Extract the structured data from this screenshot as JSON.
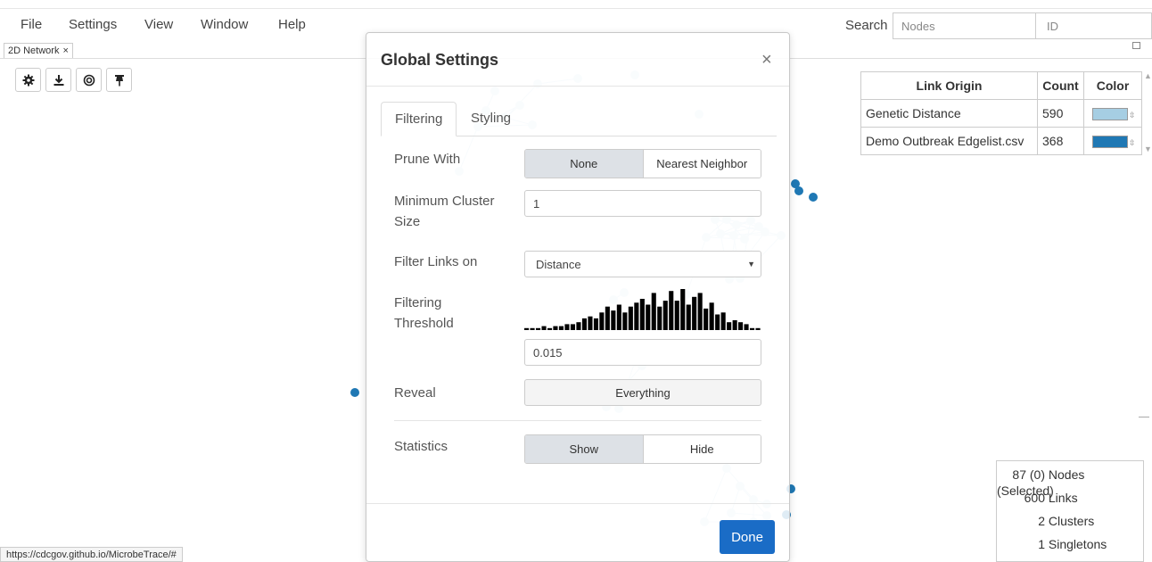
{
  "menu": {
    "items": [
      "File",
      "Settings",
      "View",
      "Window",
      "Help"
    ],
    "search_label": "Search",
    "search_placeholder": "Nodes",
    "id_placeholder": "ID"
  },
  "tab": {
    "label": "2D Network",
    "close": "×"
  },
  "toolbar": {
    "icons": [
      "gear-icon",
      "download-icon",
      "target-icon",
      "pin-icon"
    ]
  },
  "link_table": {
    "headers": [
      "Link Origin",
      "Count",
      "Color"
    ],
    "rows": [
      {
        "origin": "Genetic Distance",
        "count": "590",
        "color": "#a6cee3"
      },
      {
        "origin": "Demo Outbreak Edgelist.csv",
        "count": "368",
        "color": "#1f78b4"
      }
    ]
  },
  "stats": {
    "nodes": {
      "value": "87 (0)",
      "label": "Nodes (Selected)"
    },
    "links": {
      "value": "600",
      "label": "Links"
    },
    "clusters": {
      "value": "2",
      "label": "Clusters"
    },
    "singletons": {
      "value": "1",
      "label": "Singletons"
    }
  },
  "status_url": "https://cdcgov.github.io/MicrobeTrace/#",
  "modal": {
    "title": "Global Settings",
    "close": "×",
    "tabs": [
      "Filtering",
      "Styling"
    ],
    "prune_label": "Prune With",
    "prune_options": [
      "None",
      "Nearest Neighbor"
    ],
    "min_cluster_label": "Minimum Cluster Size",
    "min_cluster_value": "1",
    "filter_links_label": "Filter Links on",
    "filter_links_value": "Distance",
    "threshold_label": "Filtering Threshold",
    "threshold_value": "0.015",
    "reveal_label": "Reveal",
    "reveal_button": "Everything",
    "statistics_label": "Statistics",
    "statistics_options": [
      "Show",
      "Hide"
    ],
    "done_label": "Done"
  },
  "histogram_bins": [
    1,
    1,
    1,
    2,
    1,
    2,
    2,
    3,
    3,
    4,
    6,
    7,
    6,
    9,
    12,
    10,
    13,
    9,
    12,
    14,
    16,
    13,
    19,
    12,
    15,
    20,
    15,
    21,
    13,
    17,
    19,
    11,
    14,
    8,
    9,
    4,
    5,
    4,
    3,
    1,
    1
  ],
  "colors": {
    "link_light": "#a6cee3",
    "link_dark": "#1f78b4",
    "primary": "#1a6cc6"
  }
}
